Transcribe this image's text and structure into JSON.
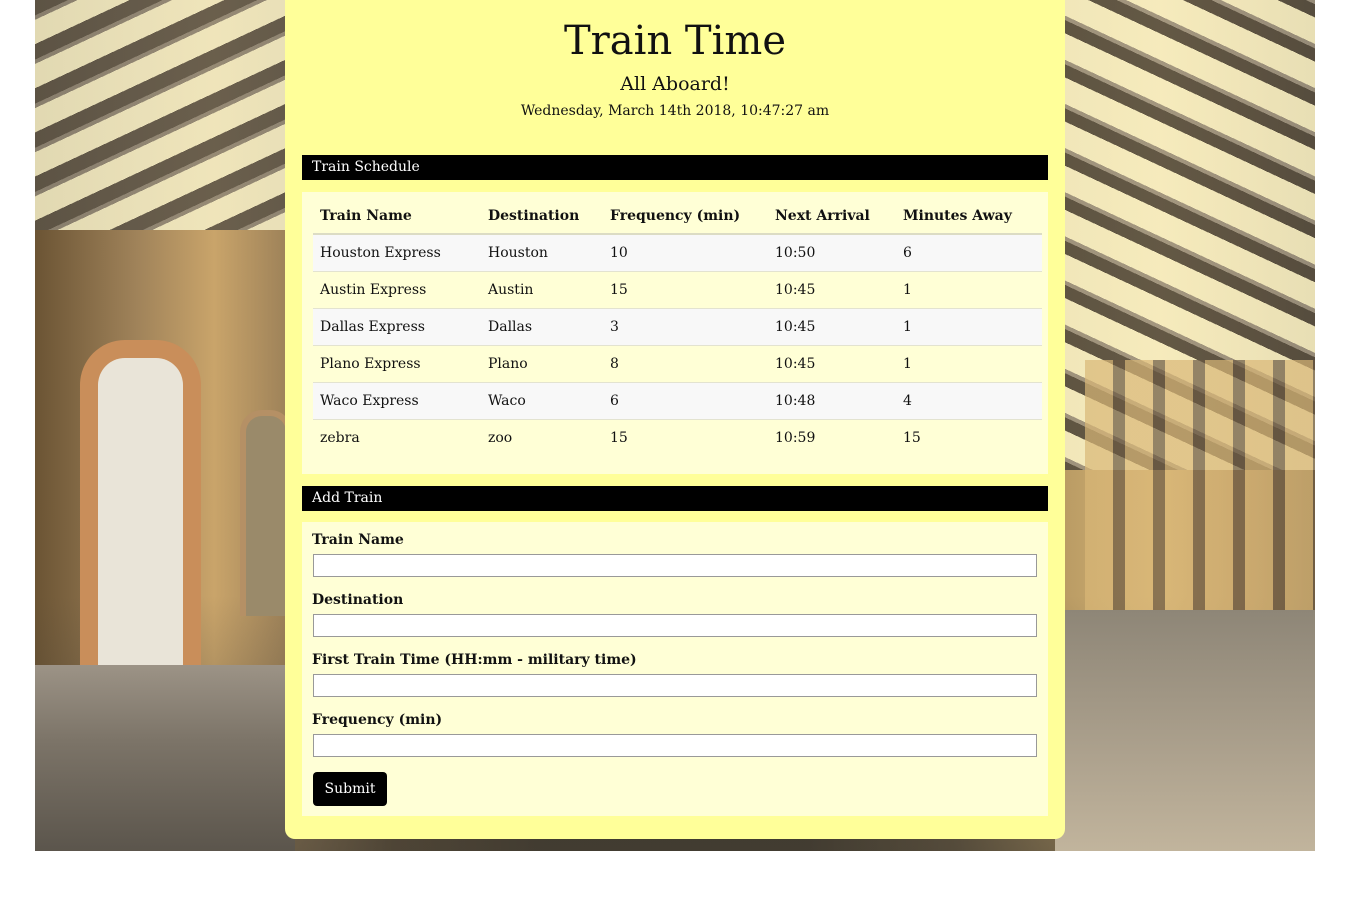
{
  "header": {
    "title": "Train Time",
    "subtitle": "All Aboard!",
    "datetime": "Wednesday, March 14th 2018, 10:47:27 am"
  },
  "schedule": {
    "section_title": "Train Schedule",
    "columns": [
      "Train Name",
      "Destination",
      "Frequency (min)",
      "Next Arrival",
      "Minutes Away"
    ],
    "rows": [
      [
        "Houston Express",
        "Houston",
        "10",
        "10:50",
        "6"
      ],
      [
        "Austin Express",
        "Austin",
        "15",
        "10:45",
        "1"
      ],
      [
        "Dallas Express",
        "Dallas",
        "3",
        "10:45",
        "1"
      ],
      [
        "Plano Express",
        "Plano",
        "8",
        "10:45",
        "1"
      ],
      [
        "Waco Express",
        "Waco",
        "6",
        "10:48",
        "4"
      ],
      [
        "zebra",
        "zoo",
        "15",
        "10:59",
        "15"
      ]
    ]
  },
  "add_train": {
    "section_title": "Add Train",
    "fields": {
      "train_name": {
        "label": "Train Name",
        "value": ""
      },
      "destination": {
        "label": "Destination",
        "value": ""
      },
      "first_time": {
        "label": "First Train Time (HH:mm - military time)",
        "value": ""
      },
      "frequency": {
        "label": "Frequency (min)",
        "value": ""
      }
    },
    "submit_label": "Submit"
  },
  "colors": {
    "panel": "#ffff99",
    "section_body": "#ffffd6",
    "section_bar": "#000000"
  }
}
